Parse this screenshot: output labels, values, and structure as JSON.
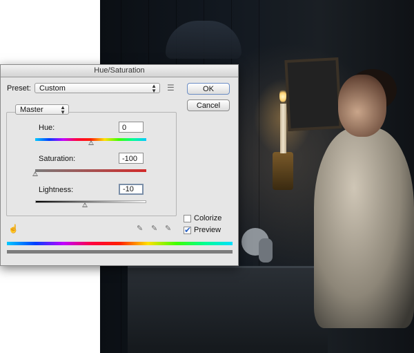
{
  "dialog": {
    "title": "Hue/Saturation",
    "preset_label": "Preset:",
    "preset_value": "Custom",
    "channel_value": "Master",
    "ok_label": "OK",
    "cancel_label": "Cancel",
    "hue": {
      "label": "Hue:",
      "value": "0",
      "slider_fraction": 0.5
    },
    "saturation": {
      "label": "Saturation:",
      "value": "-100",
      "slider_fraction": 0.0
    },
    "lightness": {
      "label": "Lightness:",
      "value": "-10",
      "slider_fraction": 0.45
    },
    "colorize": {
      "label": "Colorize",
      "checked": false
    },
    "preview": {
      "label": "Preview",
      "checked": true
    }
  },
  "icons": {
    "preset_options": "list-icon",
    "hand_tool": "targeted-adjustment-icon",
    "eyedroppers": [
      "eyedropper-icon",
      "eyedropper-plus-icon",
      "eyedropper-minus-icon"
    ]
  },
  "colors": {
    "dialog_bg": "#e6e6e6",
    "default_button_border": "#6a8cc4",
    "saturation_end": "#d22a2a"
  }
}
